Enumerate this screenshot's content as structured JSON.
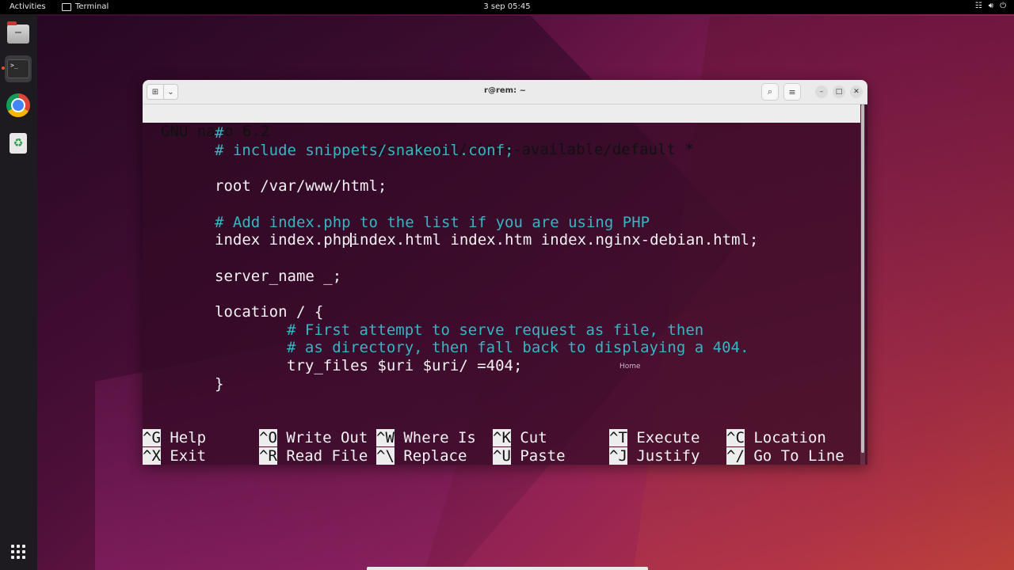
{
  "topbar": {
    "activities": "Activities",
    "app_name": "Terminal",
    "clock": "3 sep  05:45",
    "tray_icons": [
      "network-icon",
      "volume-icon",
      "power-icon"
    ]
  },
  "dock": {
    "items": [
      "files-icon",
      "terminal-icon",
      "chrome-icon",
      "trash-icon"
    ],
    "show_apps": "show-apps-icon",
    "terminal_prompt": ">_"
  },
  "window": {
    "title": "r@rem: ~",
    "new_tab_glyph": "⊞",
    "menu_chevron": "⌄",
    "search_glyph": "⌕",
    "hamburger_glyph": "≡",
    "minimize_glyph": "–",
    "maximize_glyph": "□",
    "close_glyph": "✕"
  },
  "nano": {
    "version": "GNU nano 6.2",
    "filename": "/etc/nginx/sites-available/default *",
    "lines": {
      "l1": "#",
      "l2": "# include snippets/snakeoil.conf;",
      "l3": "root /var/www/html;",
      "l4": "# Add index.php to the list if you are using PHP",
      "l5a": "index index.php",
      "l5b": "index.html index.htm index.nginx-debian.html;",
      "l6": "server_name _;",
      "l7": "location / {",
      "l8": "# First attempt to serve request as file, then",
      "l9": "# as directory, then fall back to displaying a 404.",
      "l10": "try_files $uri $uri/ =404;",
      "l11": "}"
    },
    "tooltip": "Home",
    "shortcuts": [
      {
        "key": "^G",
        "label": "Help"
      },
      {
        "key": "^O",
        "label": "Write Out"
      },
      {
        "key": "^W",
        "label": "Where Is"
      },
      {
        "key": "^K",
        "label": "Cut"
      },
      {
        "key": "^T",
        "label": "Execute"
      },
      {
        "key": "^C",
        "label": "Location"
      },
      {
        "key": "^X",
        "label": "Exit"
      },
      {
        "key": "^R",
        "label": "Read File"
      },
      {
        "key": "^\\",
        "label": "Replace"
      },
      {
        "key": "^U",
        "label": "Paste"
      },
      {
        "key": "^J",
        "label": "Justify"
      },
      {
        "key": "^/",
        "label": "Go To Line"
      }
    ]
  }
}
